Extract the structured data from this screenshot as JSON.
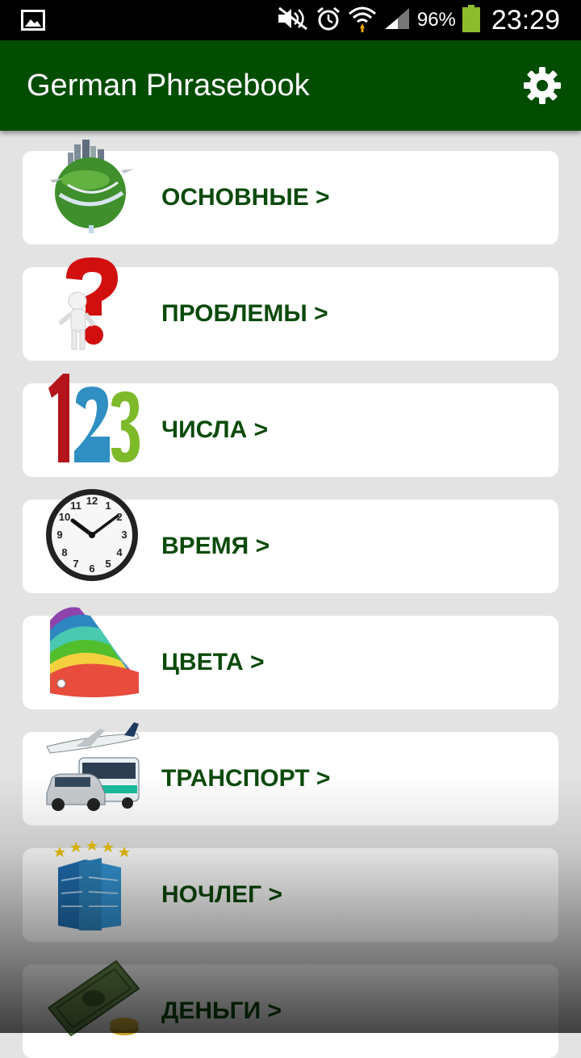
{
  "status_bar": {
    "battery_percent": "96%",
    "time": "23:29",
    "icons": [
      "image-icon",
      "mute-icon",
      "alarm-icon",
      "wifi-icon",
      "signal-icon",
      "battery-icon"
    ]
  },
  "app_bar": {
    "title": "German Phrasebook",
    "settings_icon": "gear-icon"
  },
  "categories": [
    {
      "label": "ОСНОВНЫЕ >",
      "icon": "globe-icon"
    },
    {
      "label": "ПРОБЛЕМЫ >",
      "icon": "question-mark-icon"
    },
    {
      "label": "ЧИСЛА >",
      "icon": "numbers-icon"
    },
    {
      "label": "ВРЕМЯ >",
      "icon": "clock-icon"
    },
    {
      "label": "ЦВЕТА >",
      "icon": "color-palette-icon"
    },
    {
      "label": "ТРАНСПОРТ >",
      "icon": "transport-icon"
    },
    {
      "label": "НОЧЛЕГ >",
      "icon": "hotel-icon"
    },
    {
      "label": "ДЕНЬГИ >",
      "icon": "money-icon"
    }
  ],
  "colors": {
    "app_bar": "#004d00",
    "label_text": "#0b4a0b",
    "background": "#e3e3e3"
  }
}
